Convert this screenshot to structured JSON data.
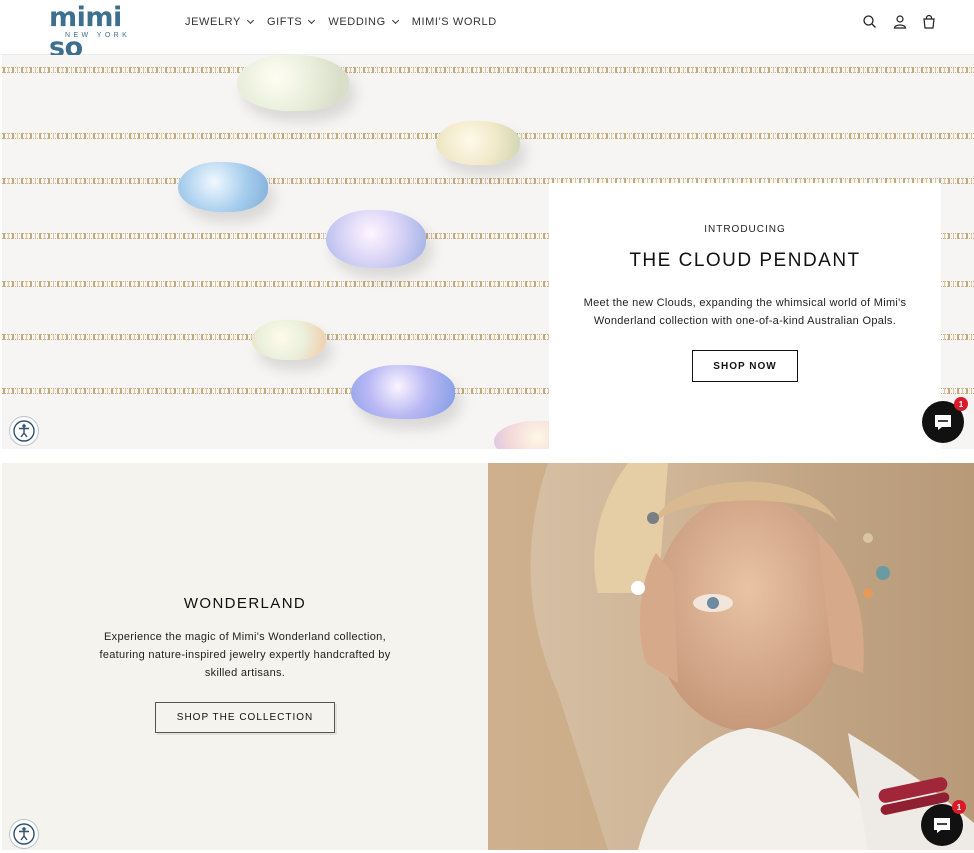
{
  "brand": {
    "name": "mimi so",
    "subtitle": "NEW YORK",
    "color": "#3d6f8e"
  },
  "nav": {
    "items": [
      {
        "label": "JEWELRY",
        "dropdown": true
      },
      {
        "label": "GIFTS",
        "dropdown": true
      },
      {
        "label": "WEDDING",
        "dropdown": true
      },
      {
        "label": "MIMI'S WORLD",
        "dropdown": false
      }
    ],
    "icons": [
      "search-icon",
      "account-icon",
      "cart-icon"
    ]
  },
  "hero": {
    "eyebrow": "INTRODUCING",
    "title": "THE CLOUD PENDANT",
    "text": "Meet the new Clouds, expanding the whimsical world of Mimi's Wonderland collection with one-of-a-kind Australian Opals.",
    "button": "SHOP NOW"
  },
  "wonderland": {
    "title": "WONDERLAND",
    "text": "Experience the magic of Mimi's Wonderland collection, featuring nature-inspired jewelry expertly handcrafted by skilled artisans.",
    "button": "SHOP THE COLLECTION"
  },
  "widgets": {
    "chat_badge_count": "1",
    "accessibility_icon": "accessibility-icon",
    "chat_icon": "chat-icon"
  },
  "colors": {
    "accent_red": "#d71b2a",
    "chat_bg": "#111111",
    "section_bg": "#f5f3ee"
  }
}
